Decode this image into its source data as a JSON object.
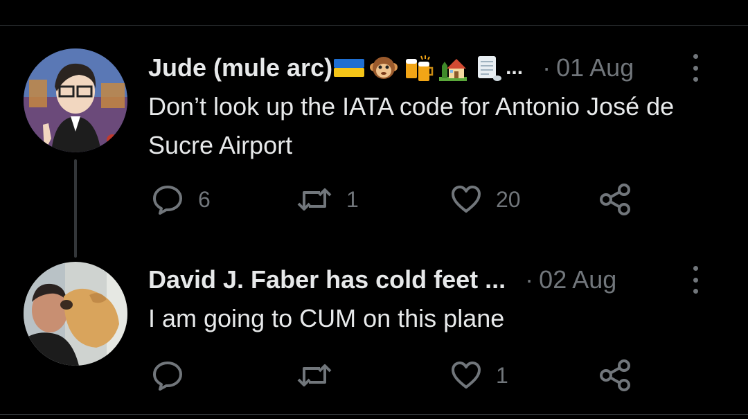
{
  "tweets": [
    {
      "display_name": "Jude (mule arc)",
      "name_emojis": [
        "ukraine-flag-emoji",
        "monkey-emoji",
        "beer-mugs-emoji",
        "house-with-garden-emoji",
        "scroll-emoji"
      ],
      "name_truncation": "...",
      "separator": "·",
      "date": "01 Aug",
      "text": "Don’t look up the IATA code for Antonio José de Sucre Airport",
      "reply_count": "6",
      "retweet_count": "1",
      "like_count": "20"
    },
    {
      "display_name": "David J. Faber has cold feet ...",
      "separator": "·",
      "date": "02 Aug",
      "text": "I am going to CUM on this plane",
      "reply_count": "",
      "retweet_count": "",
      "like_count": "1"
    }
  ],
  "colors": {
    "background": "#000000",
    "primary_text": "#e7e9ea",
    "secondary_text": "#71767b",
    "divider": "#2f3336"
  }
}
